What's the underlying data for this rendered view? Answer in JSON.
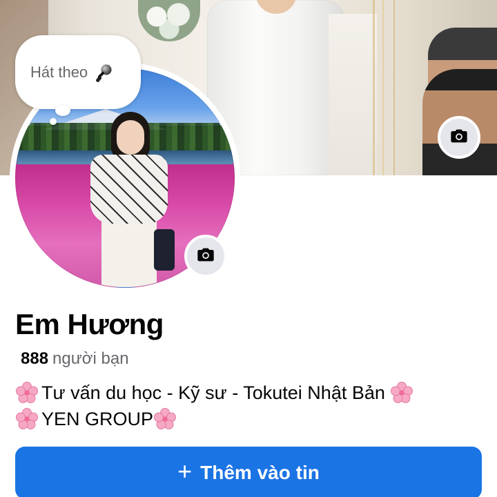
{
  "profile": {
    "name": "Em Hương",
    "friends_count": "888",
    "friends_label": "người bạn",
    "bio_line1": "Tư vấn du học - Kỹ sư - Tokutei Nhật Bản",
    "bio_line2": "YEN GROUP"
  },
  "bubble": {
    "text": "Hát theo",
    "icon": "microphone-icon"
  },
  "buttons": {
    "add_story_label": "Thêm vào tin",
    "add_story_icon": "plus-icon",
    "cover_camera_icon": "camera-icon",
    "avatar_camera_icon": "camera-icon"
  },
  "colors": {
    "accent": "#1b74e4",
    "secondary_text": "#65676b",
    "icon_button_bg": "#e4e6eb"
  }
}
